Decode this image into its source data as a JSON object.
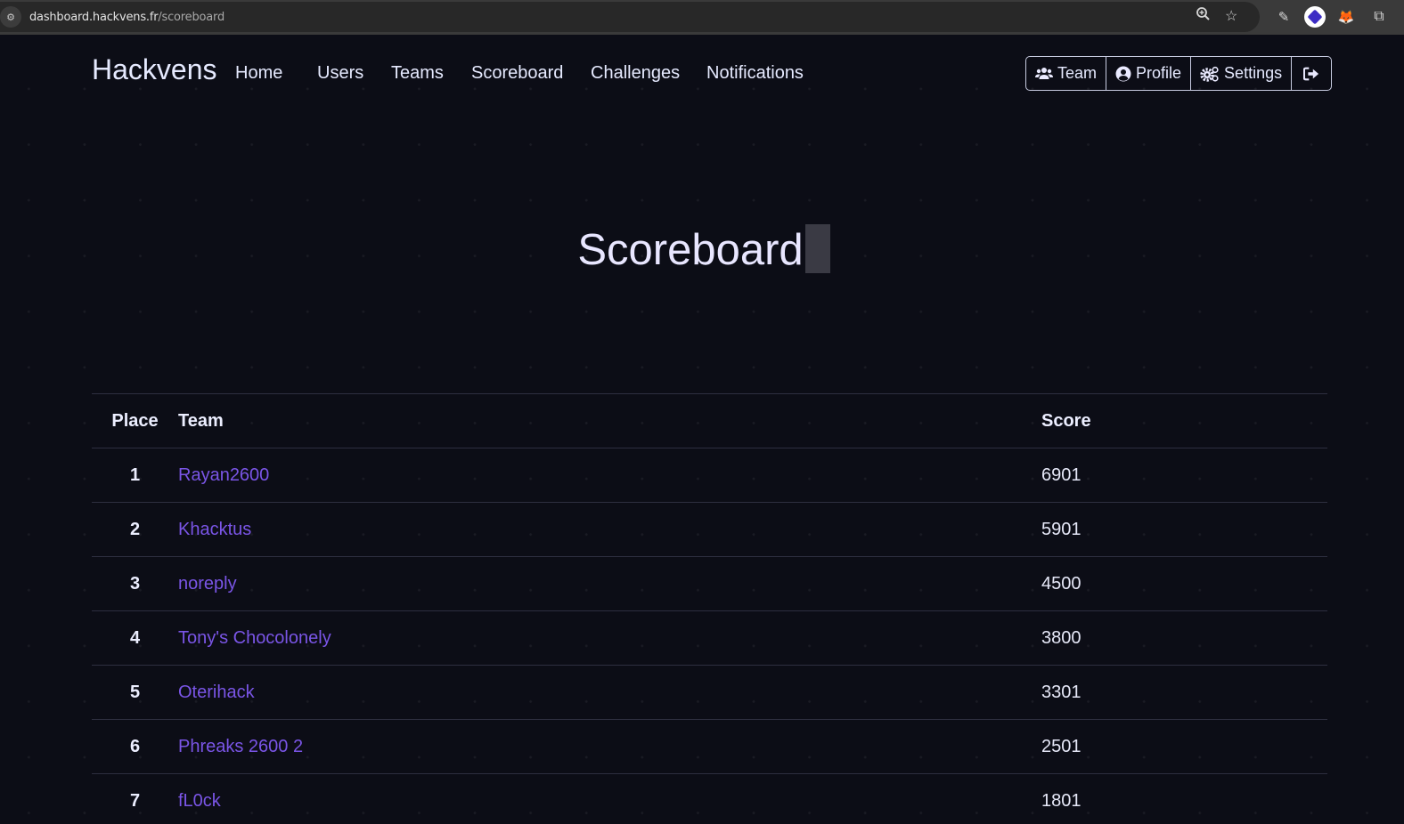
{
  "browser": {
    "url_host": "dashboard.hackvens.fr",
    "url_path": "/scoreboard",
    "icons": [
      "site-info-icon",
      "zoom-icon",
      "bookmark-star-icon",
      "eyedropper-extension-icon",
      "layers-extension-icon",
      "metamask-fox-extension-icon",
      "extensions-puzzle-icon"
    ]
  },
  "nav": {
    "brand": "Hackvens",
    "links": [
      "Home",
      "Users",
      "Teams",
      "Scoreboard",
      "Challenges",
      "Notifications"
    ],
    "actions": {
      "team": "Team",
      "profile": "Profile",
      "settings": "Settings",
      "logout_icon": "sign-out-icon"
    }
  },
  "page": {
    "title": "Scoreboard"
  },
  "table": {
    "headers": {
      "place": "Place",
      "team": "Team",
      "score": "Score"
    },
    "rows": [
      {
        "place": "1",
        "team": "Rayan2600",
        "score": "6901"
      },
      {
        "place": "2",
        "team": "Khacktus",
        "score": "5901"
      },
      {
        "place": "3",
        "team": "noreply",
        "score": "4500"
      },
      {
        "place": "4",
        "team": "Tony's Chocolonely",
        "score": "3800"
      },
      {
        "place": "5",
        "team": "Oterihack",
        "score": "3301"
      },
      {
        "place": "6",
        "team": "Phreaks 2600 2",
        "score": "2501"
      },
      {
        "place": "7",
        "team": "fL0ck",
        "score": "1801"
      }
    ]
  },
  "colors": {
    "background": "#0c0d16",
    "link": "#7a55e6",
    "text": "#e6eaff"
  }
}
